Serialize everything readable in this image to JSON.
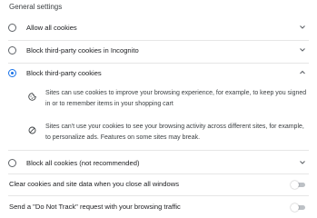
{
  "section_title": "General settings",
  "options": [
    {
      "label": "Allow all cookies",
      "selected": false,
      "expanded": false
    },
    {
      "label": "Block third-party cookies in Incognito",
      "selected": false,
      "expanded": false
    },
    {
      "label": "Block third-party cookies",
      "selected": true,
      "expanded": true
    },
    {
      "label": "Block all cookies (not recommended)",
      "selected": false,
      "expanded": false
    }
  ],
  "expanded_details": [
    {
      "icon": "cookie-icon",
      "text": "Sites can use cookies to improve your browsing experience, for example, to keep you signed in or to remember items in your shopping cart"
    },
    {
      "icon": "block-icon",
      "text": "Sites can't use your cookies to see your browsing activity across different sites, for example, to personalize ads. Features on some sites may break."
    }
  ],
  "toggles": [
    {
      "label": "Clear cookies and site data when you close all windows",
      "on": false
    },
    {
      "label": "Send a \"Do Not Track\" request with your browsing traffic",
      "on": false
    }
  ],
  "colors": {
    "accent": "#1a73e8",
    "text": "#202124",
    "secondary_text": "#3c4043",
    "divider": "#e6e6e6"
  }
}
